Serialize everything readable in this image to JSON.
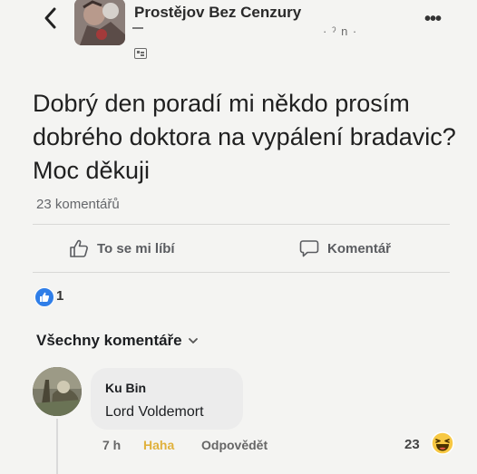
{
  "header": {
    "group_name": "Prostějov Bez Cenzury",
    "meta_text": "· ˀ n ·",
    "back_icon": "chevron-left-icon",
    "more_icon": "more-dots-icon"
  },
  "post": {
    "text": "Dobrý den poradí mi někdo prosím dobrého doktora na vypálení bradavic?Moc děkuji",
    "comment_count": "23 komentářů"
  },
  "actions": {
    "like_label": "To se mi líbí",
    "comment_label": "Komentář"
  },
  "reactions": {
    "count": "1",
    "color": "#2f7ee8"
  },
  "comments": {
    "filter_label": "Všechny komentáře",
    "items": [
      {
        "author": "Ku Bin",
        "text": "Lord Voldemort",
        "time": "7 h",
        "reaction_label": "Haha",
        "reply_label": "Odpovědět",
        "reaction_count": "23"
      }
    ]
  }
}
